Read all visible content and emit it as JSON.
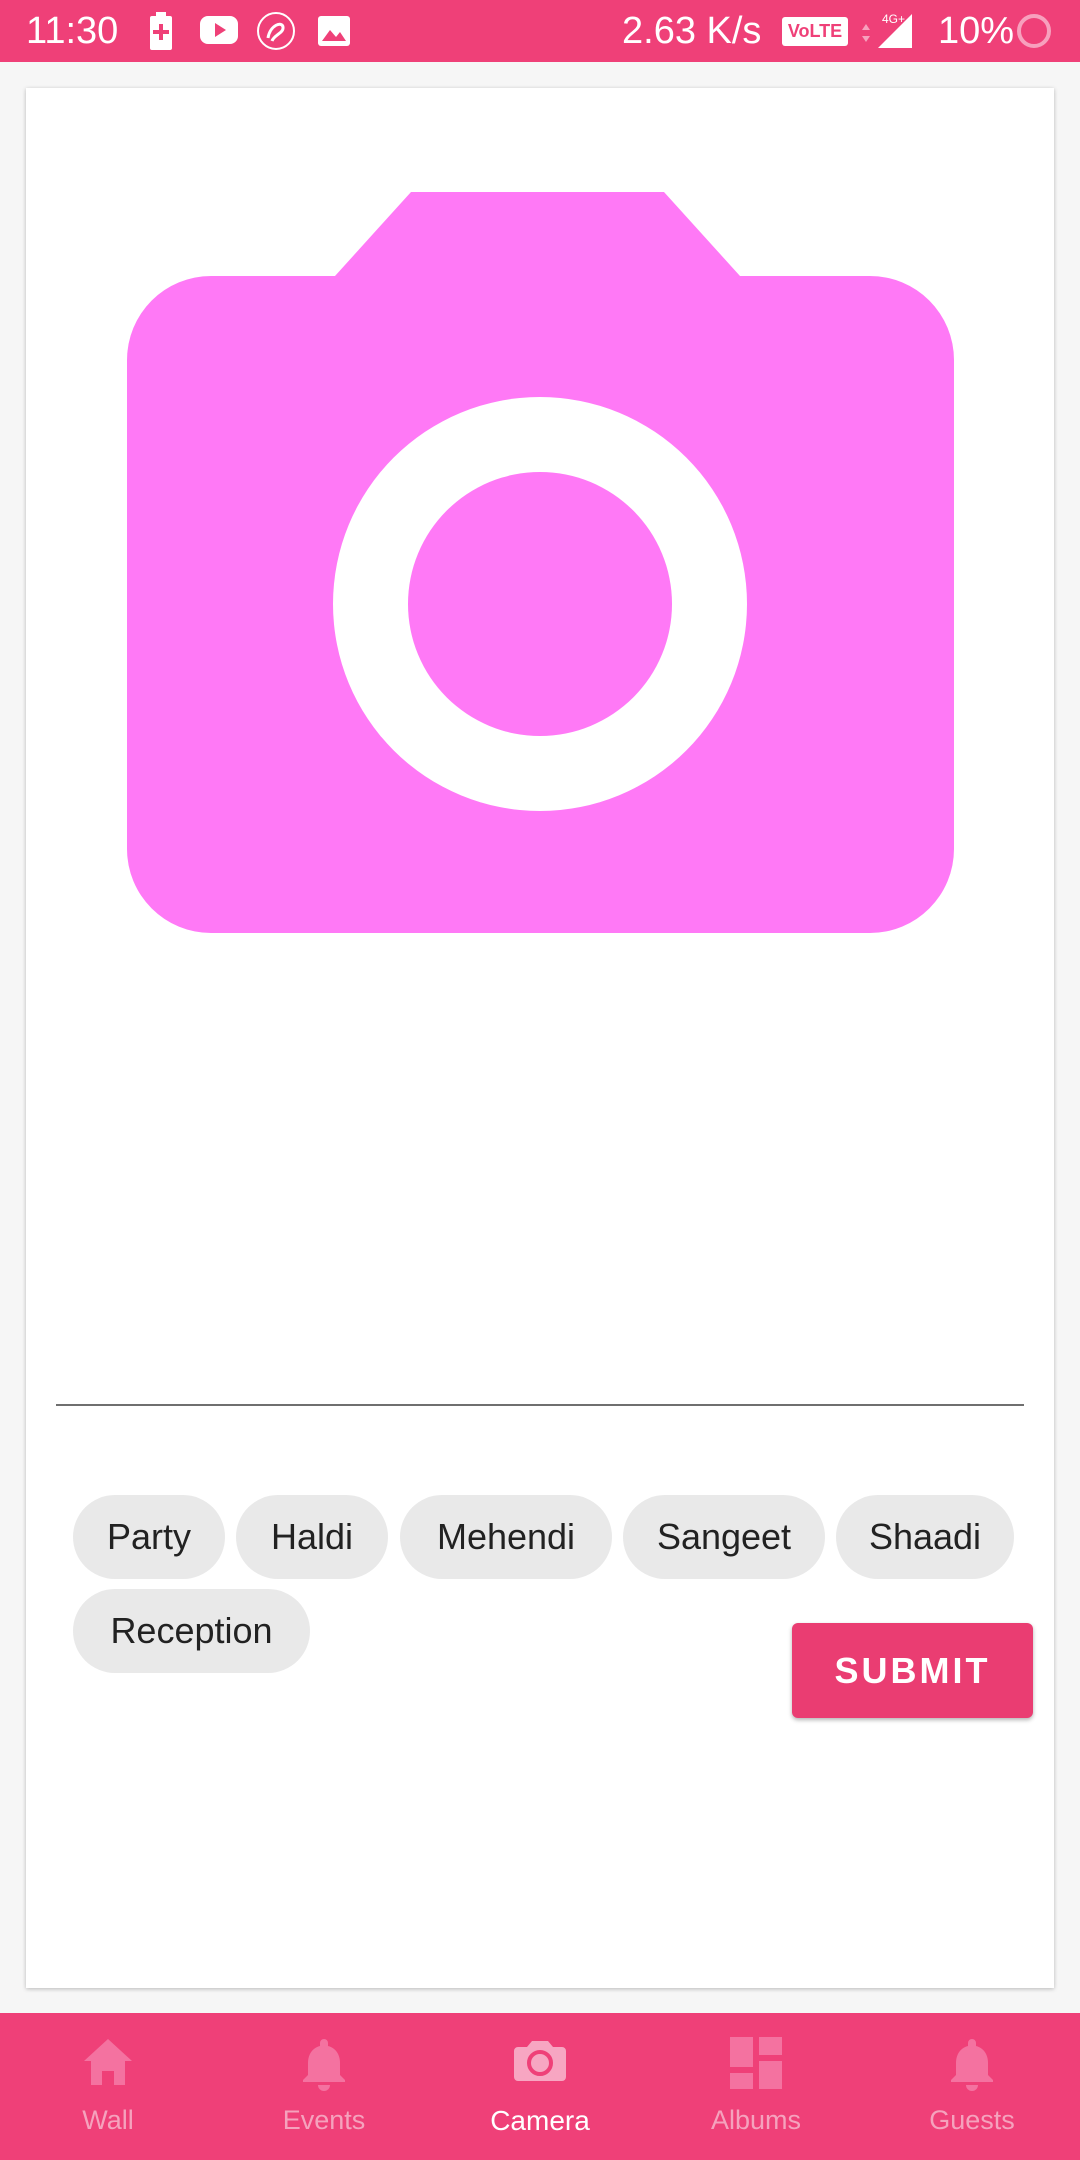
{
  "status_bar": {
    "time": "11:30",
    "network_speed": "2.63 K/s",
    "volte_label": "VoLTE",
    "network_type": "4G+",
    "battery_percent": "10%",
    "icons": [
      "battery-saver-icon",
      "youtube-icon",
      "airtel-icon",
      "gallery-icon",
      "signal-icon",
      "battery-ring-icon"
    ]
  },
  "upload": {
    "placeholder_icon": "camera-icon",
    "caption_value": "",
    "caption_placeholder": ""
  },
  "tags": [
    "Party",
    "Haldi",
    "Mehendi",
    "Sangeet",
    "Shaadi",
    "Reception"
  ],
  "submit_label": "SUBMIT",
  "bottom_nav": {
    "items": [
      {
        "label": "Wall",
        "icon": "home-icon",
        "active": false
      },
      {
        "label": "Events",
        "icon": "bell-icon",
        "active": false
      },
      {
        "label": "Camera",
        "icon": "camera-icon",
        "active": true
      },
      {
        "label": "Albums",
        "icon": "dashboard-icon",
        "active": false
      },
      {
        "label": "Guests",
        "icon": "bell-icon",
        "active": false
      }
    ]
  },
  "colors": {
    "primary": "#ef4078",
    "camera_placeholder": "#ff79f6",
    "chip_background": "#e9e9e9",
    "nav_inactive": "#f5a2bd"
  }
}
